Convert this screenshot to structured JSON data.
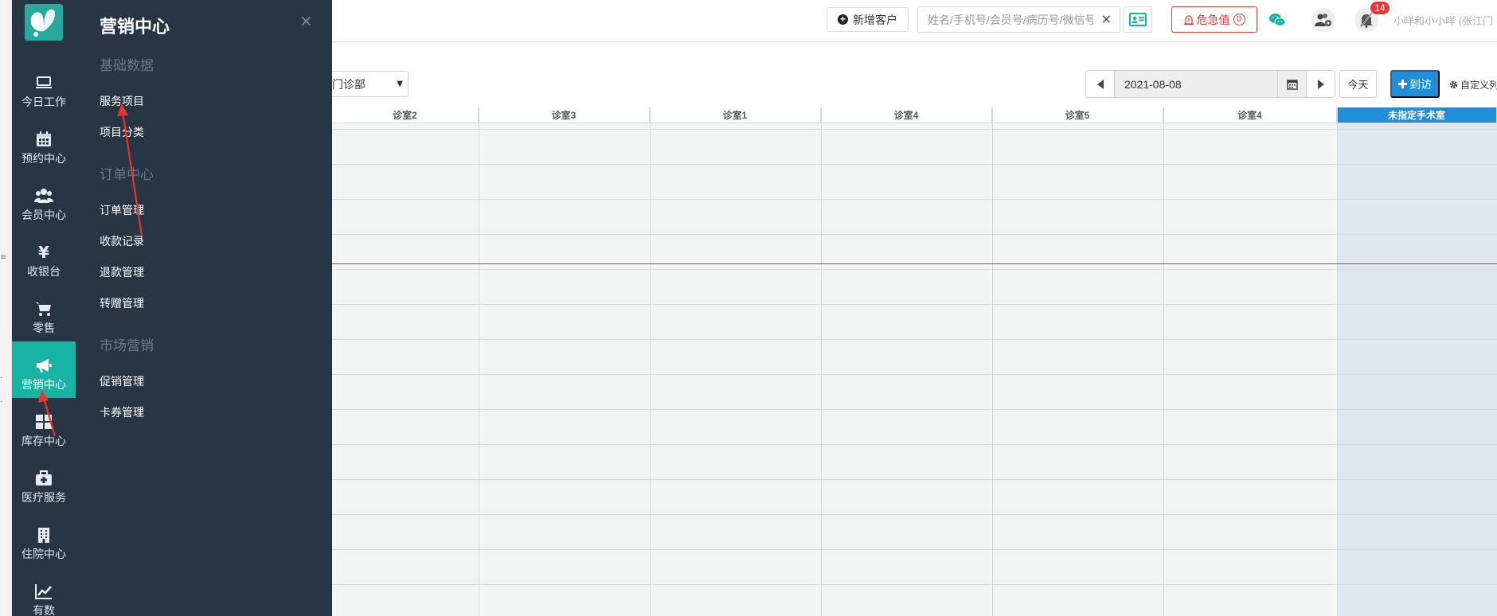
{
  "left_strip": {
    "ticks": [
      "≡",
      "·",
      "·"
    ]
  },
  "nav": {
    "items": [
      {
        "label": "今日工作",
        "icon": "laptop-icon"
      },
      {
        "label": "预约中心",
        "icon": "calendar-icon"
      },
      {
        "label": "会员中心",
        "icon": "users-icon"
      },
      {
        "label": "收银台",
        "icon": "yen-icon"
      },
      {
        "label": "零售",
        "icon": "cart-icon"
      },
      {
        "label": "营销中心",
        "icon": "megaphone-icon",
        "active": true
      },
      {
        "label": "库存中心",
        "icon": "grid-icon"
      },
      {
        "label": "医疗服务",
        "icon": "medkit-icon"
      },
      {
        "label": "住院中心",
        "icon": "hospital-icon"
      },
      {
        "label": "有数",
        "icon": "chart-line-icon"
      }
    ]
  },
  "flyout": {
    "title": "营销中心",
    "close": "×",
    "sections": [
      {
        "title": "基础数据",
        "links": [
          "服务项目",
          "项目分类"
        ]
      },
      {
        "title": "订单中心",
        "links": [
          "订单管理",
          "收款记录",
          "退款管理",
          "转赠管理"
        ]
      },
      {
        "title": "市场营销",
        "links": [
          "促销管理",
          "卡券管理"
        ]
      }
    ]
  },
  "header": {
    "new_customer": "新增客户",
    "search_placeholder": "姓名/手机号/会员号/病历号/微信号",
    "clear": "×",
    "danger_label": "危急值",
    "danger_count": "0",
    "notify_badge": "14",
    "user": "小咩和小小咩 (张江门"
  },
  "toolbar": {
    "department": "门诊部",
    "date": "2021-08-08",
    "today": "今天",
    "arrive": "到访",
    "custom": "自定义列"
  },
  "schedule": {
    "columns": [
      "诊室2",
      "诊室3",
      "诊室1",
      "诊室4",
      "诊室5",
      "诊室4",
      "未指定手术室"
    ],
    "selected_column": 6
  },
  "colors": {
    "sidebar": "#273545",
    "active": "#17b3a3",
    "primary": "#1e8fd8",
    "danger": "#e23a3a"
  }
}
